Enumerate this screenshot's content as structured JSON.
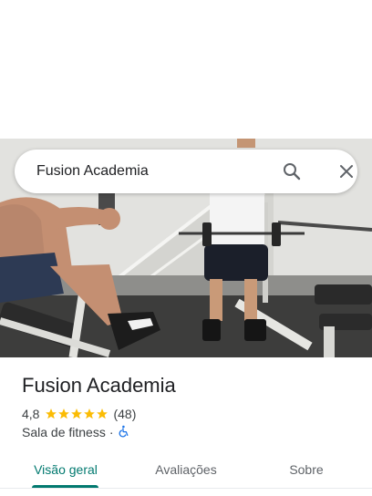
{
  "search": {
    "query": "Fusion Academia"
  },
  "place": {
    "name": "Fusion Academia",
    "rating": "4,8",
    "stars": 5,
    "review_count": "(48)",
    "category": "Sala de fitness",
    "separator": "·"
  },
  "tabs": [
    {
      "label": "Visão geral",
      "active": true
    },
    {
      "label": "Avaliações",
      "active": false
    },
    {
      "label": "Sobre",
      "active": false
    }
  ],
  "colors": {
    "accent": "#01796f",
    "star": "#fbbc04",
    "accessibility": "#1a73e8"
  },
  "icons": {
    "search": "search-icon",
    "close": "close-icon",
    "accessibility": "wheelchair-icon"
  }
}
